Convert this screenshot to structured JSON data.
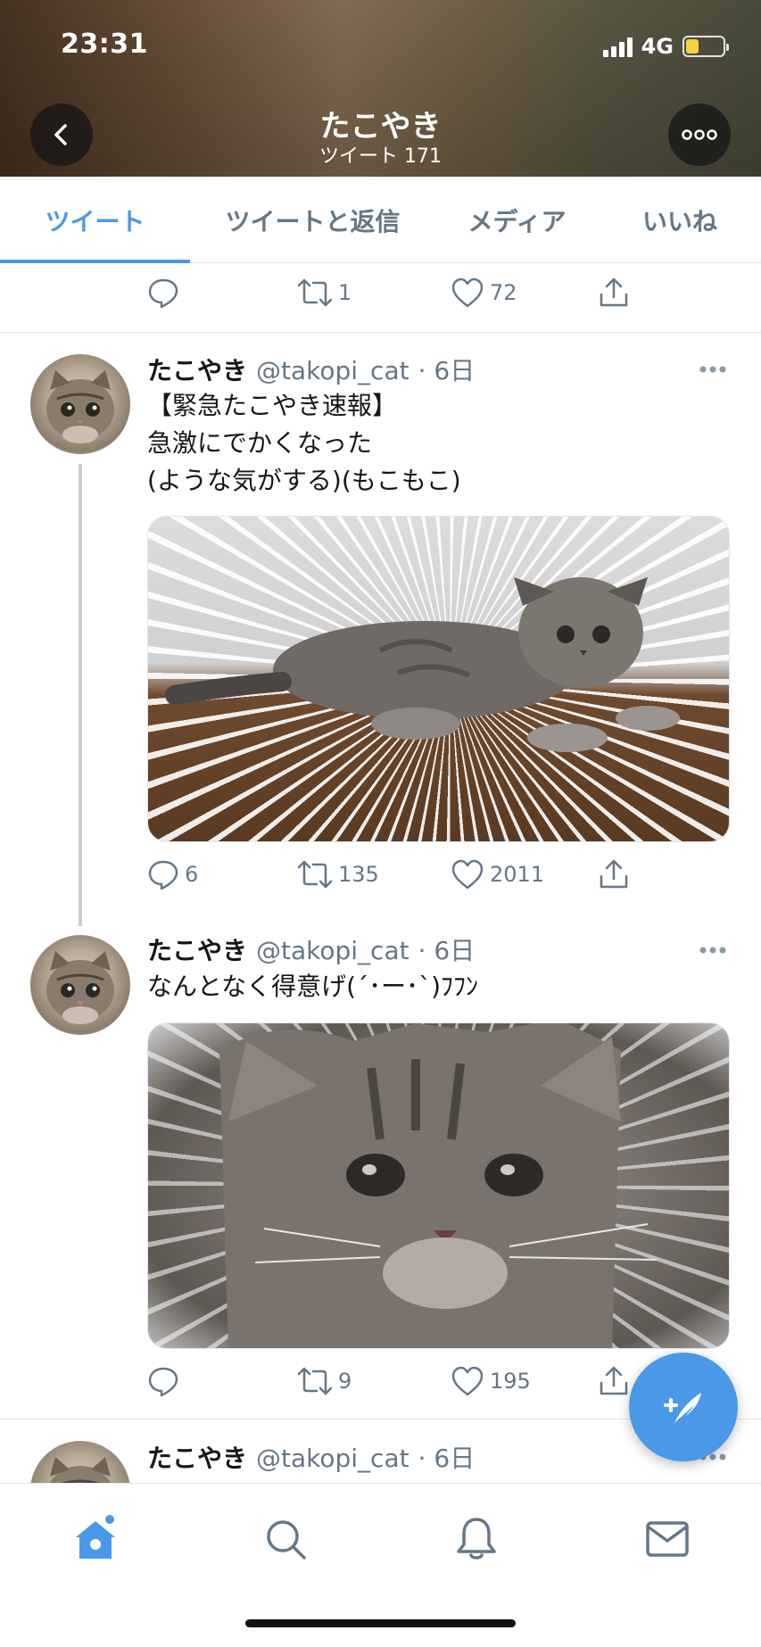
{
  "status_bar": {
    "time": "23:31",
    "network": "4G",
    "battery_level_fraction": 0.35,
    "battery_color": "#f6d13c"
  },
  "header": {
    "title": "たこやき",
    "subtitle": "ツイート 171",
    "back_icon": "chevron-left-icon",
    "more_icon": "more-horizontal-icon"
  },
  "tabs": [
    {
      "label": "ツイート",
      "active": true
    },
    {
      "label": "ツイートと返信",
      "active": false
    },
    {
      "label": "メディア",
      "active": false
    },
    {
      "label": "いいね",
      "active": false
    }
  ],
  "accent_color": "#4a99e9",
  "top_actions": {
    "reply_count": "",
    "retweet_count": "1",
    "like_count": "72"
  },
  "tweets": [
    {
      "name": "たこやき",
      "handle": "@takopi_cat",
      "time": "· 6日",
      "lines": [
        "【緊急たこやき速報】",
        "急激にでかくなった",
        "(ような気がする)(もこもこ)"
      ],
      "reply_count": "6",
      "retweet_count": "135",
      "like_count": "2011"
    },
    {
      "name": "たこやき",
      "handle": "@takopi_cat",
      "time": "· 6日",
      "lines": [
        "なんとなく得意げ(´･ー･`)ﾌﾌﾝ"
      ],
      "reply_count": "",
      "retweet_count": "9",
      "like_count": "195"
    },
    {
      "name": "たこやき",
      "handle": "@takopi_cat",
      "time": "· 6日"
    }
  ],
  "fab_icon": "compose-tweet-icon",
  "bottom_nav": [
    {
      "icon": "home-icon",
      "active": true
    },
    {
      "icon": "search-icon",
      "active": false
    },
    {
      "icon": "notifications-bell-icon",
      "active": false
    },
    {
      "icon": "messages-envelope-icon",
      "active": false
    }
  ]
}
